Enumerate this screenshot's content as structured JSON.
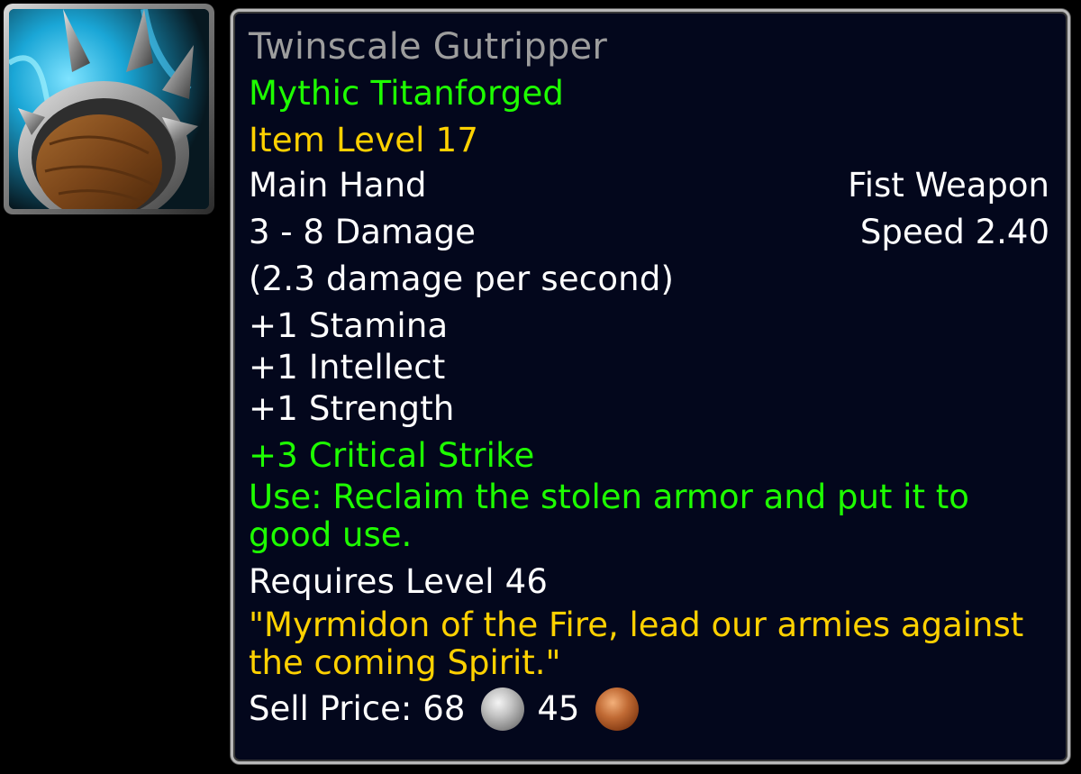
{
  "icon": {
    "name": "fist-weapon-icon"
  },
  "tooltip": {
    "item_name": "Twinscale Gutripper",
    "quality_tier": "Mythic Titanforged",
    "item_level": "Item Level 17",
    "slot": "Main Hand",
    "weapon_type": "Fist Weapon",
    "damage": "3 - 8 Damage",
    "speed": "Speed 2.40",
    "dps": "(2.3 damage per second)",
    "stats": [
      "+1 Stamina",
      "+1 Intellect",
      "+1 Strength"
    ],
    "secondary_stat": "+3 Critical Strike",
    "use_effect": "Use: Reclaim the stolen armor and put it to good use.",
    "requirement": "Requires Level 46",
    "flavor_text": "\"Myrmidon of the Fire, lead our armies against the coming Spirit.\"",
    "sell_price": {
      "label": "Sell Price:",
      "silver": "68",
      "copper": "45"
    }
  },
  "colors": {
    "item_name_poor": "#9d9d9d",
    "green": "#1eff00",
    "gold": "#ffd100",
    "white": "#ffffff",
    "background": "#03071c",
    "border": "#b8b8b8"
  }
}
